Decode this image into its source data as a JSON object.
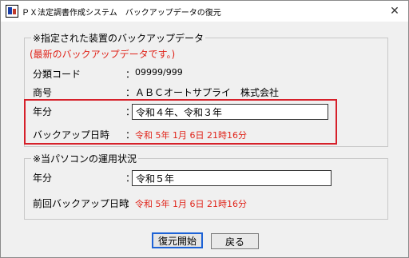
{
  "window": {
    "title": "ＰＸ法定調書作成システム　バックアップデータの復元",
    "close_glyph": "✕"
  },
  "backup_group": {
    "legend": "※指定された装置のバックアップデータ",
    "note": "(最新のバックアップデータです。)",
    "rows": {
      "classification_code": {
        "label": "分類コード",
        "value": "09999/999"
      },
      "trade_name": {
        "label": "商号",
        "value": "ＡＢＣオートサプライ　株式会社"
      },
      "fiscal_years": {
        "label": "年分",
        "value": "令和４年、令和３年"
      },
      "backup_datetime": {
        "label": "バックアップ日時",
        "value": "令和 5年 1月 6日 21時16分"
      }
    }
  },
  "pc_group": {
    "legend": "※当パソコンの運用状況",
    "rows": {
      "fiscal_year": {
        "label": "年分",
        "value": "令和５年"
      },
      "last_backup_datetime": {
        "label": "前回バックアップ日時",
        "value": "令和 5年 1月 6日 21時16分"
      }
    }
  },
  "colon": "：",
  "buttons": {
    "restore": "復元開始",
    "back": "戻る"
  },
  "colors": {
    "highlight": "#d6202a",
    "emphasis_text": "#e0241a",
    "default_button_border": "#1e63d6"
  }
}
